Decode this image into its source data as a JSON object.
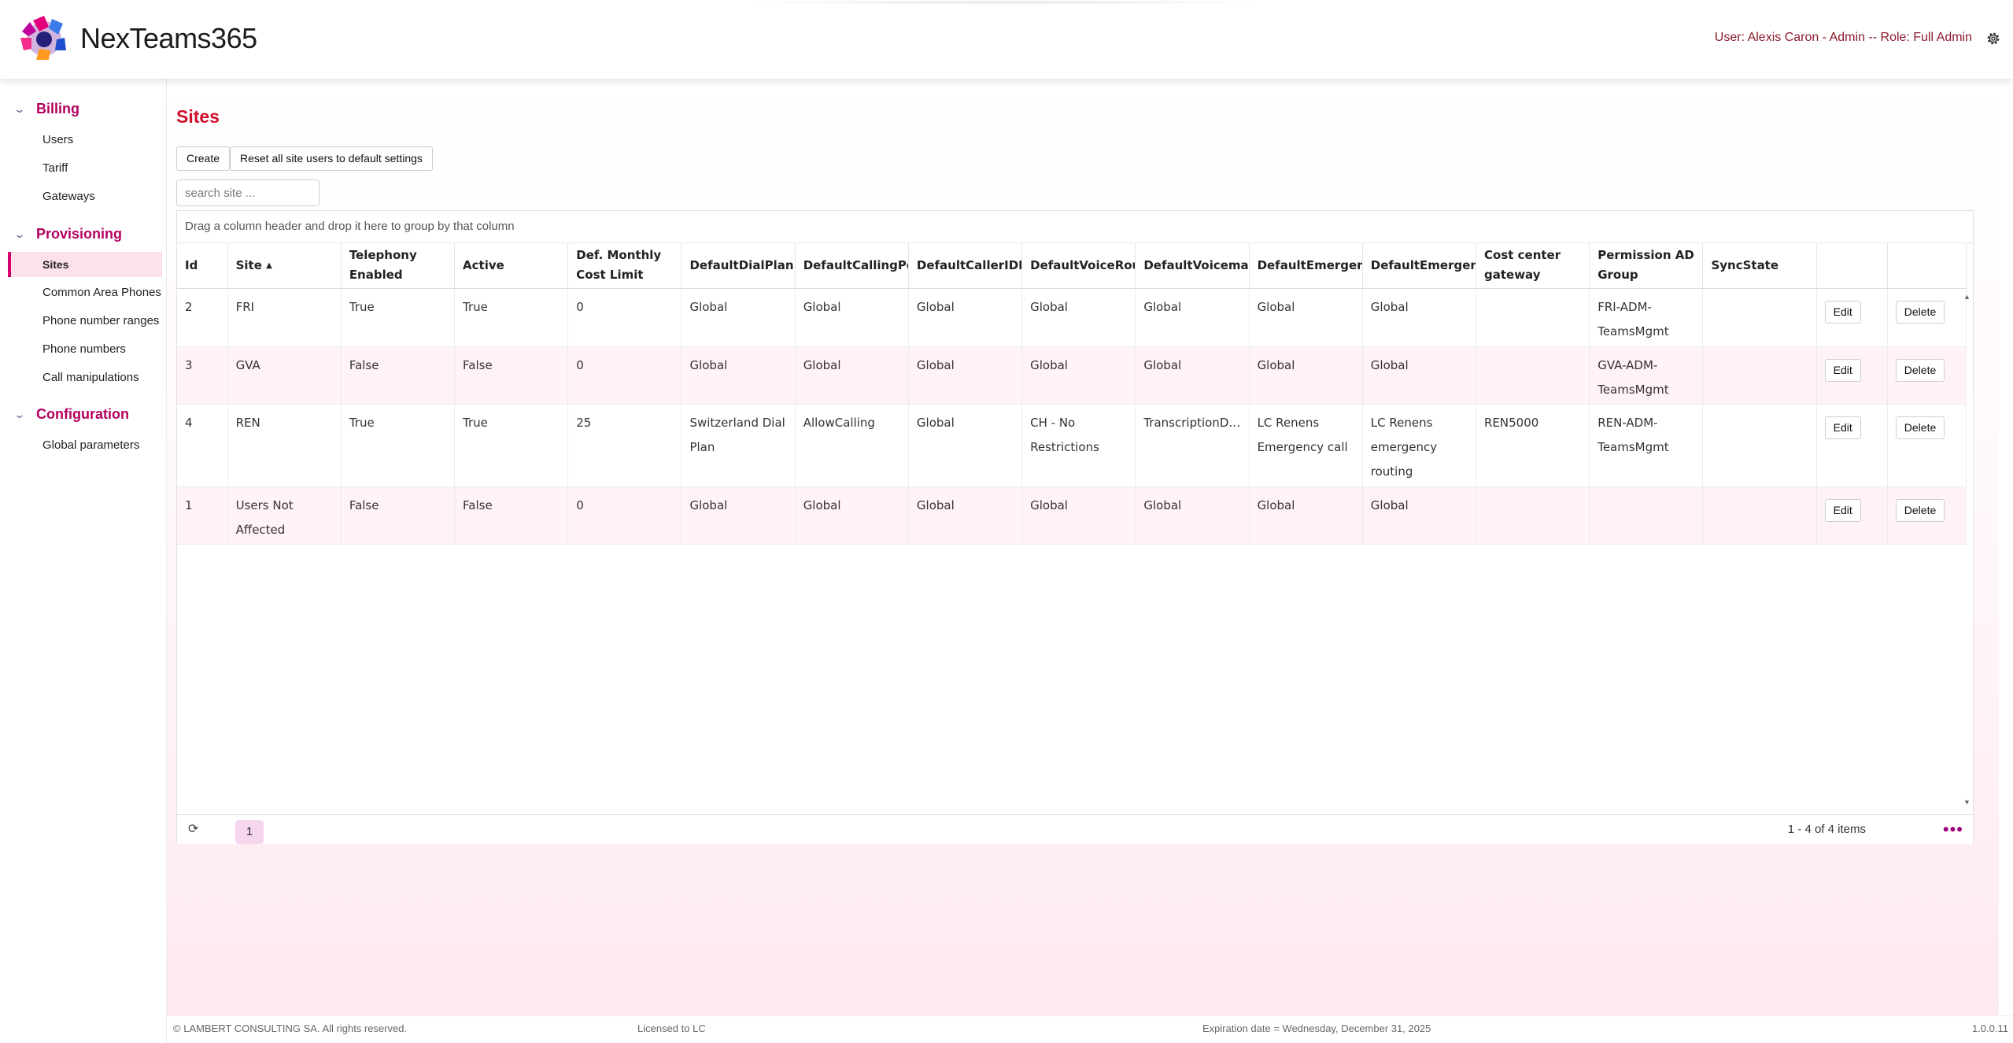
{
  "header": {
    "brand": "NexTeams365",
    "user_info": "User: Alexis Caron - Admin -- Role: Full Admin",
    "settings_icon": "gear-icon"
  },
  "sidebar": {
    "groups": [
      {
        "title": "Billing",
        "items": [
          "Users",
          "Tariff",
          "Gateways"
        ]
      },
      {
        "title": "Provisioning",
        "items": [
          "Sites",
          "Common Area Phones",
          "Phone number ranges",
          "Phone numbers",
          "Call manipulations"
        ]
      },
      {
        "title": "Configuration",
        "items": [
          "Global parameters"
        ]
      }
    ],
    "active_item": "Sites"
  },
  "main": {
    "title": "Sites",
    "create_label": "Create",
    "reset_label": "Reset all site users to default settings",
    "search_placeholder": "search site ...",
    "group_hint": "Drag a column header and drop it here to group by that column"
  },
  "table": {
    "headers": [
      "Id",
      "Site",
      "Telephony Enabled",
      "Active",
      "Def. Monthly Cost Limit",
      "DefaultDialPlan",
      "DefaultCallingPol",
      "DefaultCallerIDP",
      "DefaultVoiceRou",
      "DefaultVoicemail",
      "DefaultEmergenc",
      "DefaultEmergenc",
      "Cost center gateway",
      "Permission AD Group",
      "SyncState",
      "",
      ""
    ],
    "sorted_column": "Site",
    "rows": [
      {
        "id": "2",
        "site": "FRI",
        "telephony": "True",
        "active": "True",
        "cost": "0",
        "dialplan": "Global",
        "calling": "Global",
        "callerid": "Global",
        "voiceroute": "Global",
        "voicemail": "Global",
        "emerg1": "Global",
        "emerg2": "Global",
        "gateway": "",
        "adgroup": "FRI-ADM-TeamsMgmt",
        "sync": ""
      },
      {
        "id": "3",
        "site": "GVA",
        "telephony": "False",
        "active": "False",
        "cost": "0",
        "dialplan": "Global",
        "calling": "Global",
        "callerid": "Global",
        "voiceroute": "Global",
        "voicemail": "Global",
        "emerg1": "Global",
        "emerg2": "Global",
        "gateway": "",
        "adgroup": "GVA-ADM-TeamsMgmt",
        "sync": ""
      },
      {
        "id": "4",
        "site": "REN",
        "telephony": "True",
        "active": "True",
        "cost": "25",
        "dialplan": "Switzerland Dial Plan",
        "calling": "AllowCalling",
        "callerid": "Global",
        "voiceroute": "CH - No Restrictions",
        "voicemail": "TranscriptionDi...",
        "emerg1": "LC Renens Emergency call",
        "emerg2": "LC Renens emergency routing",
        "gateway": "REN5000",
        "adgroup": "REN-ADM-TeamsMgmt",
        "sync": ""
      },
      {
        "id": "1",
        "site": "Users Not Affected",
        "telephony": "False",
        "active": "False",
        "cost": "0",
        "dialplan": "Global",
        "calling": "Global",
        "callerid": "Global",
        "voiceroute": "Global",
        "voicemail": "Global",
        "emerg1": "Global",
        "emerg2": "Global",
        "gateway": "",
        "adgroup": "",
        "sync": ""
      }
    ],
    "edit_label": "Edit",
    "delete_label": "Delete"
  },
  "pager": {
    "current_page": "1",
    "info": "1 - 4 of 4 items",
    "more": "•••"
  },
  "footer": {
    "copyright": "© LAMBERT CONSULTING SA. All rights reserved.",
    "license": "Licensed to LC",
    "expiration": "Expiration date = Wednesday, December 31, 2025",
    "version": "1.0.0.11"
  },
  "colors": {
    "accent": "#b3005e",
    "title": "#d0102a",
    "active_bg": "#fde2ea",
    "row_alt": "#fff3f6"
  }
}
